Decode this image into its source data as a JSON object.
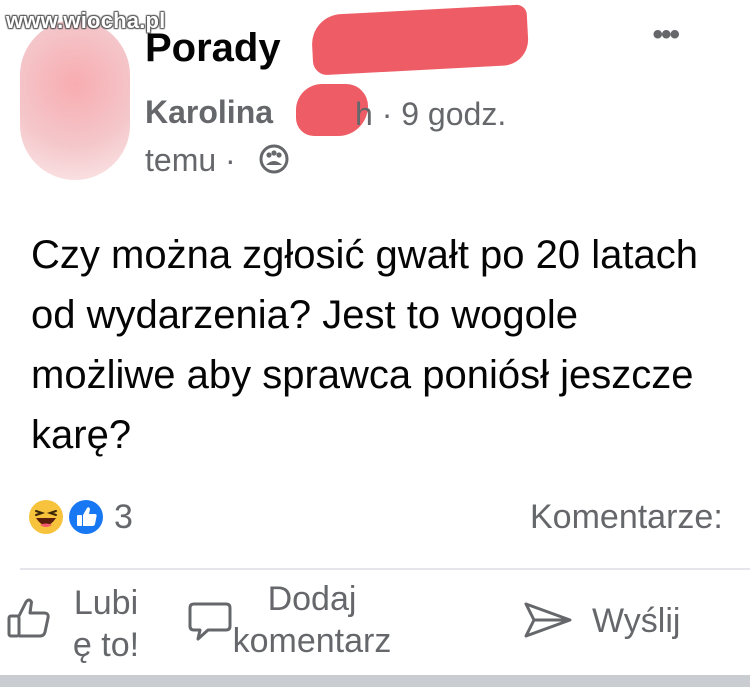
{
  "watermark": "www.wiocha.pl",
  "post": {
    "group_name": "Porady",
    "author": "Karolina",
    "author_suffix": "h · 9 godz.",
    "time_rest": "temu ·",
    "text": "Czy można zgłosić gwałt po 20 latach od wydarzenia? Jest to wogole możliwe aby sprawca poniósł jeszcze karę?",
    "more_icon": "more-options-icon",
    "audience_icon": "group-audience-icon"
  },
  "reactions": {
    "count": "3",
    "types": [
      "haha",
      "like"
    ],
    "comments_label": "Komentarze:"
  },
  "actions": {
    "like_line1": "Lubi",
    "like_line2": "ę to!",
    "comment_line1": "Dodaj",
    "comment_line2": "komentarz",
    "share": "Wyślij"
  },
  "colors": {
    "text": "#050505",
    "secondary": "#65676b",
    "like_blue": "#1877f2",
    "haha_yellow": "#f7c33c",
    "redaction": "#ee5d66"
  }
}
